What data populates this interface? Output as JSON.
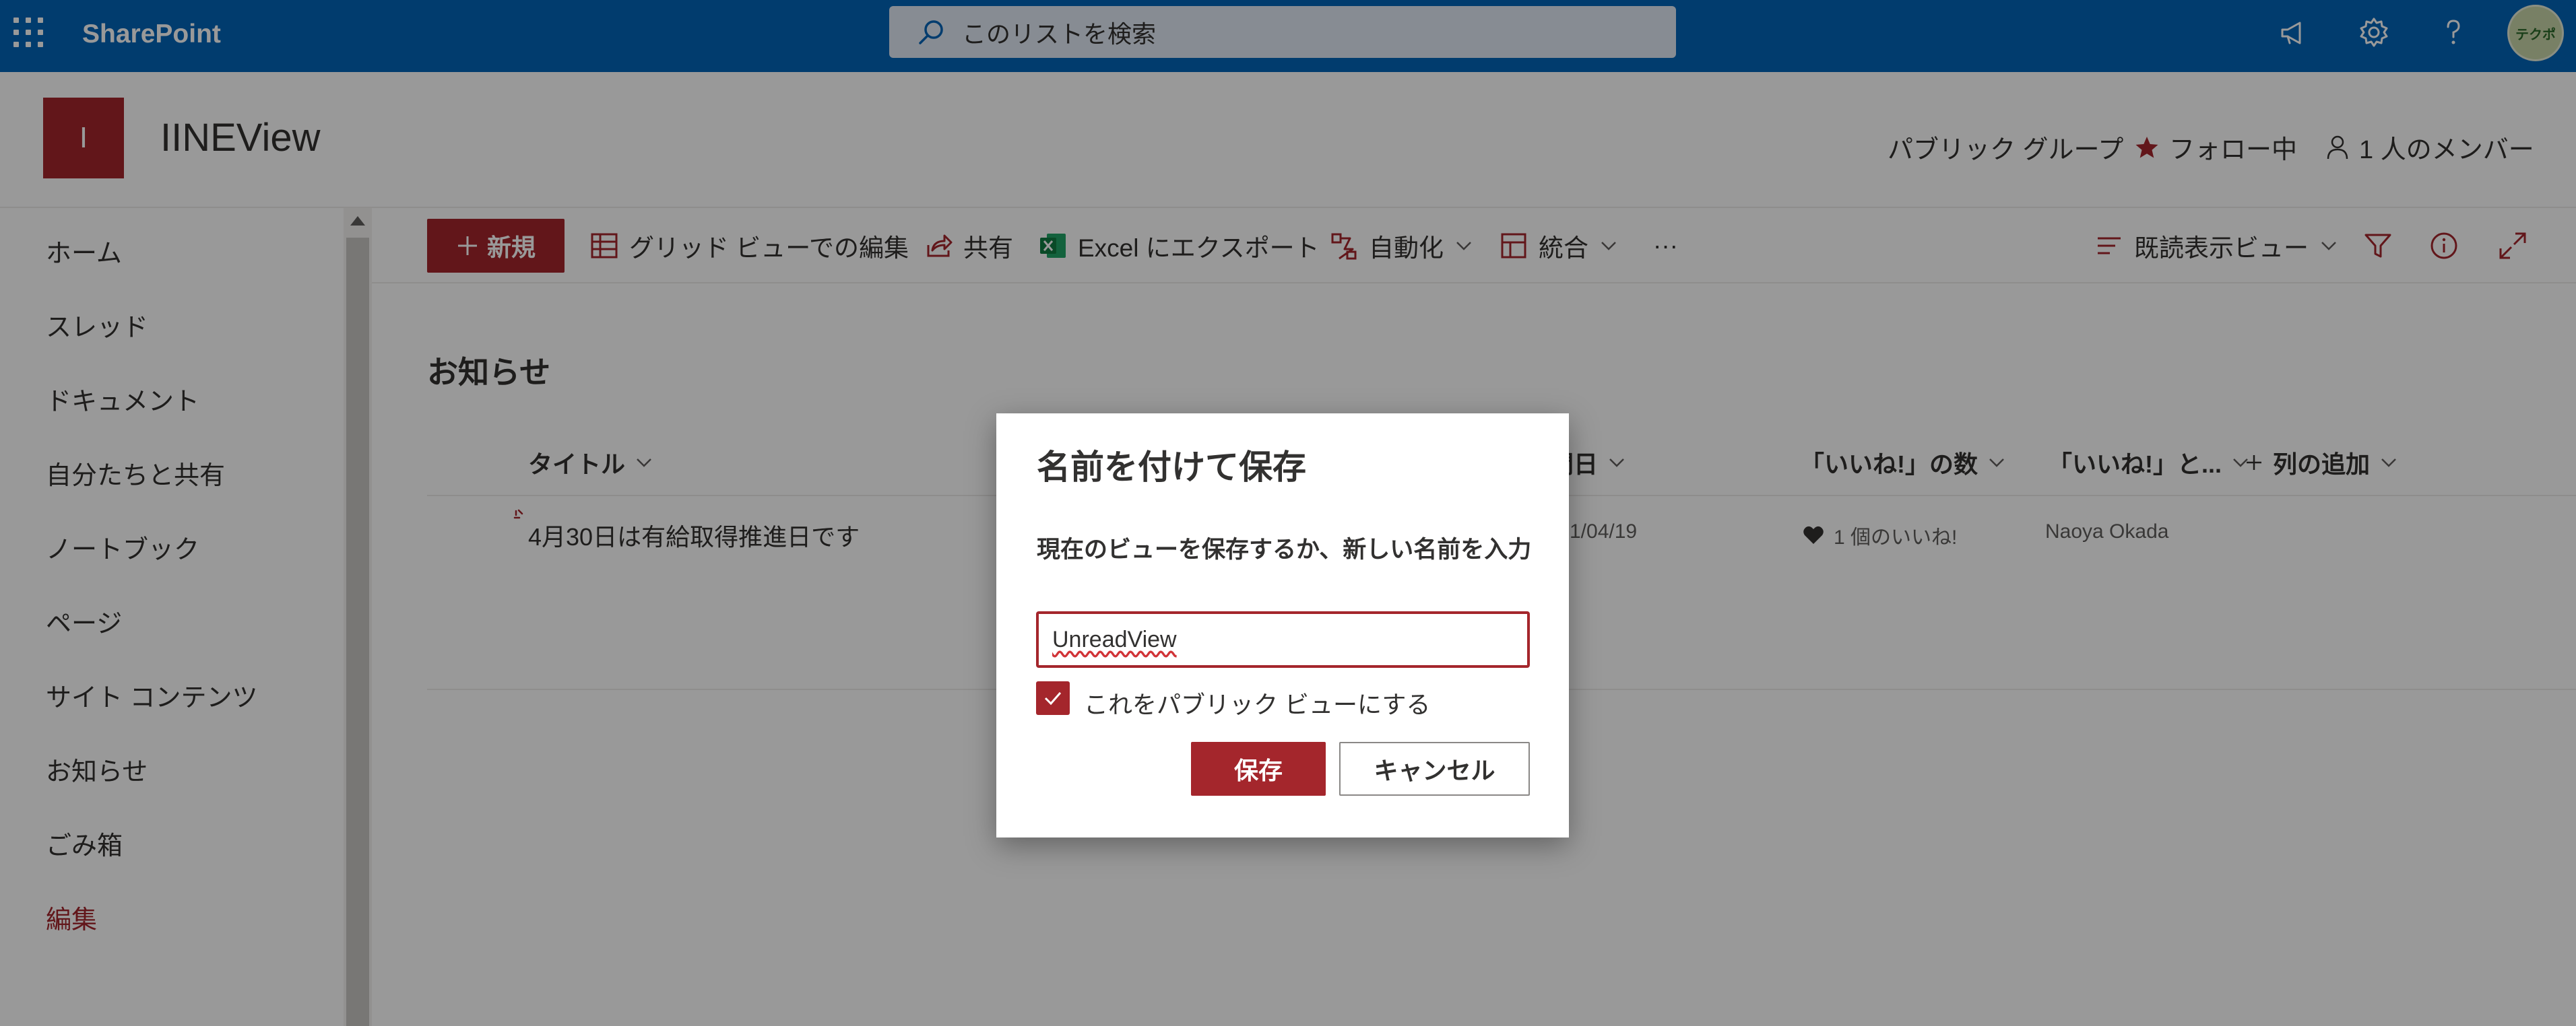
{
  "suitebar": {
    "brand": "SharePoint",
    "search_placeholder": "このリストを検索",
    "avatar_initials": "テクポ"
  },
  "site": {
    "logo_letter": "I",
    "title": "IINEView",
    "group_type": "パブリック グループ",
    "follow_label": "フォロー中",
    "members_label": "1 人のメンバー"
  },
  "nav": {
    "items": [
      {
        "label": "ホーム"
      },
      {
        "label": "スレッド"
      },
      {
        "label": "ドキュメント"
      },
      {
        "label": "自分たちと共有"
      },
      {
        "label": "ノートブック"
      },
      {
        "label": "ページ"
      },
      {
        "label": "サイト コンテンツ"
      },
      {
        "label": "お知らせ"
      },
      {
        "label": "ごみ箱"
      }
    ],
    "edit_label": "編集"
  },
  "commandbar": {
    "new_label": "新規",
    "grid_edit_label": "グリッド ビューでの編集",
    "share_label": "共有",
    "export_label": "Excel にエクスポート",
    "automate_label": "自動化",
    "integrate_label": "統合",
    "more_label": "···",
    "view_label": "既読表示ビュー"
  },
  "list": {
    "title": "お知らせ",
    "columns": {
      "title": "タイトル",
      "date": "開日",
      "likes_count": "「いいね!」の数",
      "liked_by": "「いいね!」と...",
      "add_column": "列の追加"
    },
    "rows": [
      {
        "title": "4月30日は有給取得推進日です",
        "date": "1/04/19",
        "likes": "1 個のいいね!",
        "liked_by": "Naoya Okada"
      }
    ]
  },
  "dialog": {
    "title": "名前を付けて保存",
    "label": "現在のビューを保存するか、新しい名前を入力",
    "input_value": "UnreadView",
    "checkbox_label": "これをパブリック ビューにする",
    "checkbox_checked": true,
    "save_label": "保存",
    "cancel_label": "キャンセル"
  },
  "colors": {
    "suitebar": "#0364b8",
    "accent": "#a4262c"
  }
}
